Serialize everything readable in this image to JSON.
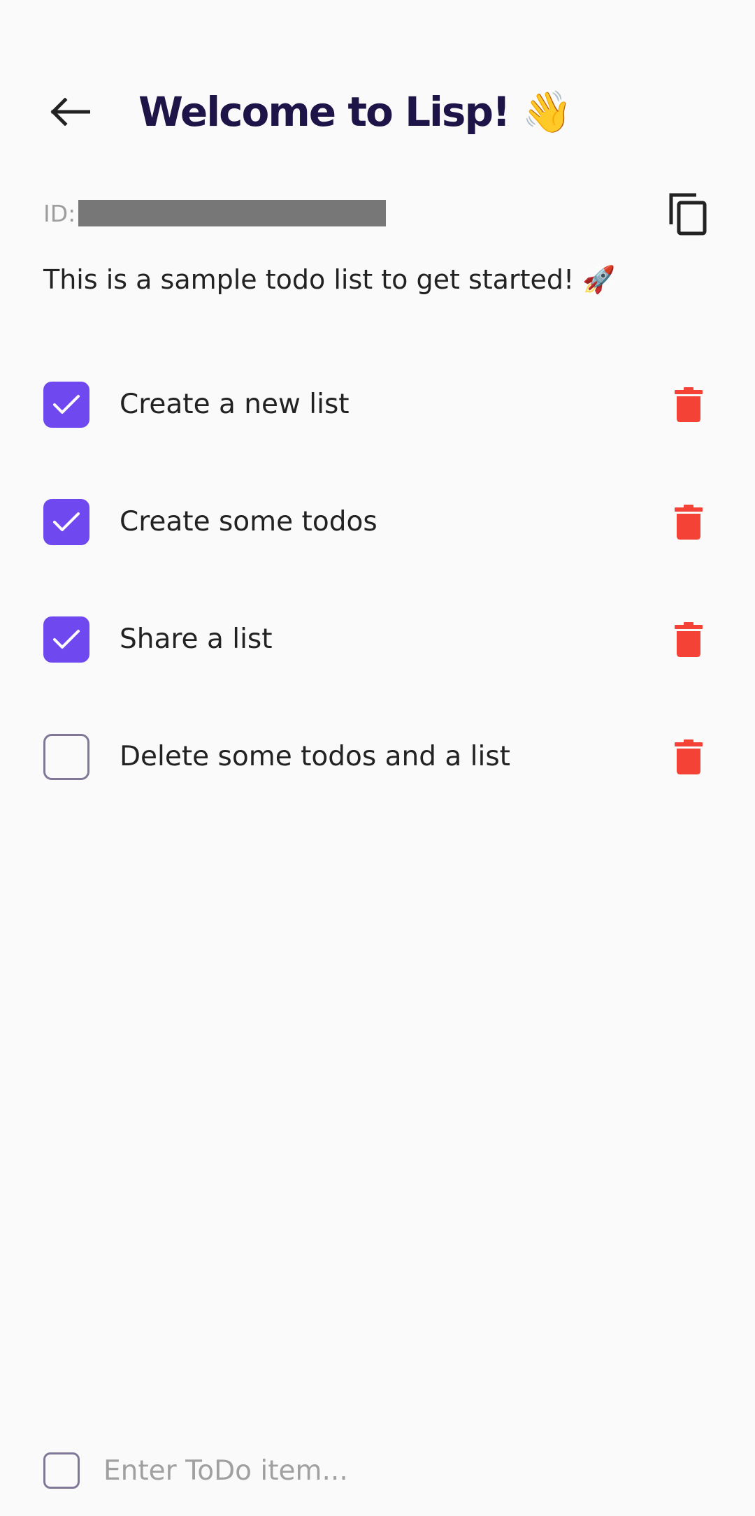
{
  "header": {
    "back_icon": "arrow-left-icon",
    "title": "Welcome to Lisp! 👋"
  },
  "list_id": {
    "label": "ID:",
    "value_redacted": true,
    "copy_icon": "copy-icon"
  },
  "description": "This is a sample todo list to get started! 🚀",
  "todos": [
    {
      "text": "Create a new list",
      "checked": true
    },
    {
      "text": "Create some todos",
      "checked": true
    },
    {
      "text": "Share a list",
      "checked": true
    },
    {
      "text": "Delete some todos and a list",
      "checked": false
    }
  ],
  "new_todo": {
    "placeholder": "Enter ToDo item...",
    "value": ""
  },
  "colors": {
    "accent": "#7048f0",
    "title": "#1e1448",
    "delete": "#f44336",
    "background": "#fafafa"
  },
  "icons": {
    "check": "check-icon",
    "delete": "trash-icon"
  }
}
